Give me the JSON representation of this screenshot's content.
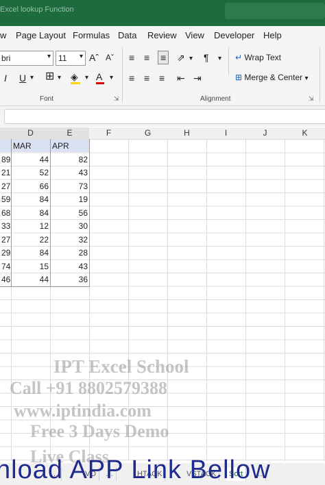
{
  "window": {
    "title": "Excel lookup Function"
  },
  "menu": [
    "w",
    "Page Layout",
    "Formulas",
    "Data",
    "Review",
    "View",
    "Developer",
    "Help"
  ],
  "ribbon": {
    "font_name": "bri",
    "font_size": "11",
    "font_group_label": "Font",
    "alignment_group_label": "Alignment",
    "wrap_text_label": "Wrap Text",
    "merge_center_label": "Merge & Center",
    "fill_color": "#ffd400",
    "font_color": "#e00000"
  },
  "grid": {
    "columns": [
      "D",
      "E",
      "F",
      "G",
      "H",
      "I",
      "J",
      "K"
    ],
    "headers": [
      "MAR",
      "APR"
    ],
    "rows": [
      [
        "89",
        "44",
        "82"
      ],
      [
        "21",
        "52",
        "43"
      ],
      [
        "27",
        "66",
        "73"
      ],
      [
        "59",
        "84",
        "19"
      ],
      [
        "68",
        "84",
        "56"
      ],
      [
        "33",
        "12",
        "30"
      ],
      [
        "27",
        "22",
        "32"
      ],
      [
        "29",
        "84",
        "28"
      ],
      [
        "74",
        "15",
        "43"
      ],
      [
        "46",
        "44",
        "36"
      ]
    ]
  },
  "watermark": {
    "line1": "IPT Excel School",
    "line2": "Call +91 8802579388",
    "line3": "www.iptindia.com",
    "line4": "Free 3 Days Demo",
    "line5": "Live Class"
  },
  "sheet_tabs": [
    "…",
    "VO",
    "…",
    "HTACK",
    "VSTACK",
    "Sort",
    "…"
  ],
  "banner": {
    "text": "nload APP Link Bellow"
  }
}
